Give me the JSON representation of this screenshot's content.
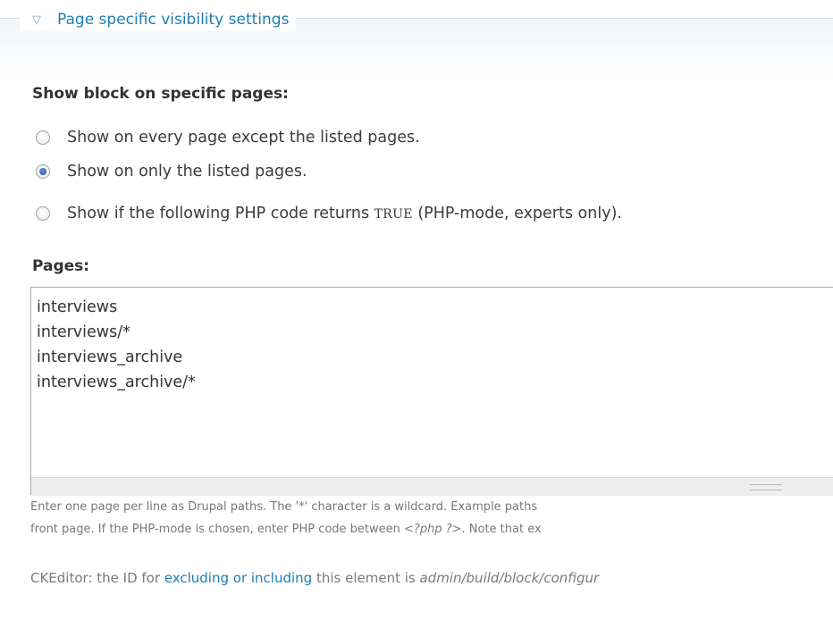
{
  "fieldset": {
    "toggle_icon": "triangle-down-icon",
    "legend": "Page specific visibility settings"
  },
  "visibility": {
    "label": "Show block on specific pages:",
    "options": [
      {
        "label": "Show on every page except the listed pages.",
        "checked": false
      },
      {
        "label": "Show on only the listed pages.",
        "checked": true
      },
      {
        "label_before": "Show if the following PHP code returns ",
        "code": "TRUE",
        "label_after": " (PHP-mode, experts only).",
        "checked": false
      }
    ]
  },
  "pages": {
    "label": "Pages:",
    "value": "interviews\ninterviews/*\ninterviews_archive\ninterviews_archive/*",
    "description_line1": "Enter one page per line as Drupal paths. The '*' character is a wildcard. Example paths",
    "description_line2_before": "front page. If the PHP-mode is chosen, enter PHP code between ",
    "description_line2_code": "<?php ?>",
    "description_line2_after": ". Note that ex"
  },
  "ckeditor": {
    "before": "CKEditor: the ID for ",
    "link": "excluding or including",
    "middle": " this element is ",
    "path": "admin/build/block/configur"
  },
  "colors": {
    "link": "#1e7cb8",
    "text": "#3b3b3b",
    "muted": "#777777",
    "radio_checked": "#1f4f9a"
  }
}
